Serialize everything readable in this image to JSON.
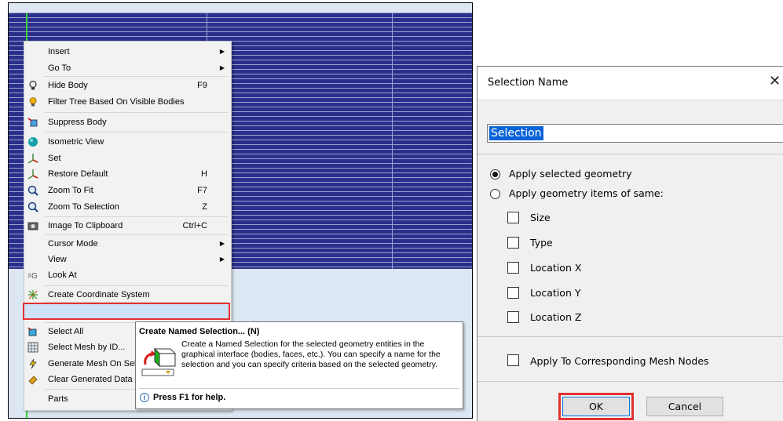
{
  "context_menu": {
    "items": [
      {
        "label": "Insert",
        "shortcut": "",
        "submenu": true,
        "icon": ""
      },
      {
        "label": "Go To",
        "shortcut": "",
        "submenu": true,
        "icon": ""
      },
      {
        "label": "Hide Body",
        "shortcut": "F9",
        "submenu": false,
        "icon": "bulb-outline-icon"
      },
      {
        "label": "Filter Tree Based On Visible Bodies",
        "shortcut": "",
        "submenu": false,
        "icon": "bulb-filled-icon"
      },
      {
        "label": "Suppress Body",
        "shortcut": "",
        "submenu": false,
        "icon": "suppress-body-icon"
      },
      {
        "label": "Isometric View",
        "shortcut": "",
        "submenu": false,
        "icon": "sphere-icon"
      },
      {
        "label": "Set",
        "shortcut": "",
        "submenu": false,
        "icon": "axes-icon"
      },
      {
        "label": "Restore Default",
        "shortcut": "H",
        "submenu": false,
        "icon": "axes-icon"
      },
      {
        "label": "Zoom To Fit",
        "shortcut": "F7",
        "submenu": false,
        "icon": "zoom-icon"
      },
      {
        "label": "Zoom To Selection",
        "shortcut": "Z",
        "submenu": false,
        "icon": "zoom-icon"
      },
      {
        "label": "Image To Clipboard",
        "shortcut": "Ctrl+C",
        "submenu": false,
        "icon": "camera-icon"
      },
      {
        "label": "Cursor Mode",
        "shortcut": "",
        "submenu": true,
        "icon": ""
      },
      {
        "label": "View",
        "shortcut": "",
        "submenu": true,
        "icon": ""
      },
      {
        "label": "Look At",
        "shortcut": "",
        "submenu": false,
        "icon": "look-at-icon"
      },
      {
        "label": "Create Coordinate System",
        "shortcut": "",
        "submenu": false,
        "icon": "coordinate-system-icon"
      },
      {
        "label": "Create Named Selection...",
        "shortcut": "N",
        "submenu": false,
        "icon": "named-selection-icon"
      },
      {
        "label": "Select All",
        "shortcut": "",
        "submenu": false,
        "icon": "select-all-icon"
      },
      {
        "label": "Select Mesh by ID...",
        "shortcut": "",
        "submenu": false,
        "icon": "mesh-id-icon"
      },
      {
        "label": "Generate Mesh On Sele",
        "shortcut": "",
        "submenu": false,
        "icon": "lightning-icon"
      },
      {
        "label": "Clear Generated Data C",
        "shortcut": "",
        "submenu": false,
        "icon": "eraser-icon"
      },
      {
        "label": "Parts",
        "shortcut": "",
        "submenu": false,
        "icon": ""
      }
    ]
  },
  "tooltip": {
    "title": "Create Named Selection... (N)",
    "description": "Create a Named Selection for the selected geometry entities in the graphical interface (bodies, faces, etc.). You can specify a name for the selection and you can specify criteria based on the selected geometry.",
    "help": "Press F1 for help."
  },
  "dialog": {
    "title": "Selection Name",
    "close_glyph": "✕",
    "name_value": "Selection",
    "clear_glyph": "✕",
    "radio_selected": "Apply selected geometry",
    "radio_same": "Apply geometry items of same:",
    "checkboxes": [
      "Size",
      "Type",
      "Location X",
      "Location Y",
      "Location Z"
    ],
    "mesh_nodes": "Apply To Corresponding Mesh Nodes",
    "ok": "OK",
    "cancel": "Cancel"
  },
  "colors": {
    "mesh": "#2a2f8c",
    "highlight_outline": "#e53030",
    "selection_blue": "#0a64d8"
  }
}
